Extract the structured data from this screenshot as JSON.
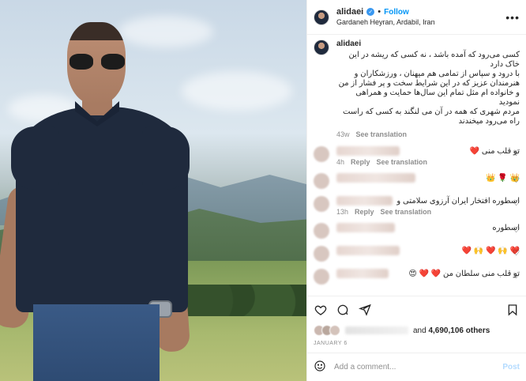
{
  "post": {
    "username": "alidaei",
    "follow_label": "Follow",
    "separator": "•",
    "location": "Gardaneh Heyran, Ardabil, Iran"
  },
  "caption": {
    "username": "alidaei",
    "text": "کسی می‌رود که آمده باشد ، نه کسی که ریشه در این خاک دارد\nبا درود و سپاس از تمامی هم میهنان ، ورزشکاران و هنرمندان عزیز که در این شرایط سخت و پر فشار از من و خانواده ام مثل تمام این سال‌ها حمایت و همراهی نمودید\nمردم شهری که همه در آن می لنگند به کسی که راست راه می‌رود میخندند",
    "time": "43w",
    "see_translation": "See translation"
  },
  "comments": [
    {
      "text": "تو قلب منی ❤️",
      "time": "4h",
      "reply": "Reply",
      "see_translation": "See translation",
      "show_meta": true
    },
    {
      "text": "👑 🌹 👑",
      "time": "",
      "reply": "",
      "see_translation": "",
      "show_meta": false
    },
    {
      "text": "اسطوره افتخار ایران آرزوی سلامتی و",
      "time": "13h",
      "reply": "Reply",
      "see_translation": "See translation",
      "show_meta": true
    },
    {
      "text": "اسطوره",
      "time": "",
      "reply": "",
      "see_translation": "",
      "show_meta": false
    },
    {
      "text": "❤️ 🙌 ❤️ 🙌 ❤️",
      "time": "",
      "reply": "",
      "see_translation": "",
      "show_meta": false
    },
    {
      "text": "تو قلب منی سلطان من ❤️ ❤️ 😍",
      "time": "",
      "reply": "",
      "see_translation": "",
      "show_meta": false
    }
  ],
  "likes": {
    "and_label": "and",
    "count": "4,690,106",
    "others_label": "others"
  },
  "date": "JANUARY 6",
  "add_comment": {
    "placeholder": "Add a comment...",
    "post_label": "Post"
  },
  "icons": {
    "more": "more-options-icon",
    "like": "heart-icon",
    "comment": "comment-icon",
    "share": "share-icon",
    "save": "bookmark-icon",
    "emoji": "emoji-icon",
    "verified": "verified-badge-icon"
  },
  "colors": {
    "accent": "#0095f6",
    "verified": "#3897f0",
    "muted": "#8e8e8e",
    "text": "#262626"
  }
}
